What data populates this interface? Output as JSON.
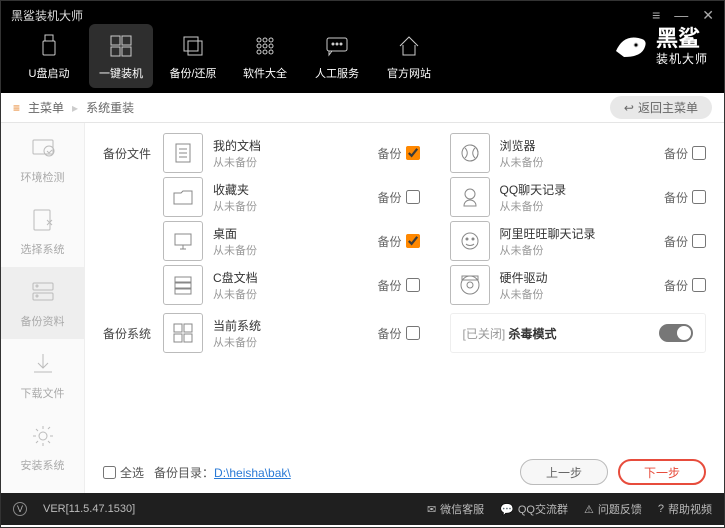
{
  "app_title": "黑鲨装机大师",
  "winctl": {
    "menu": "≡",
    "min": "—",
    "close": "✕"
  },
  "brand": {
    "name": "黑鲨",
    "sub": "装机大师"
  },
  "nav": [
    {
      "label": "U盘启动",
      "icon": "usb"
    },
    {
      "label": "一键装机",
      "icon": "windows"
    },
    {
      "label": "备份/还原",
      "icon": "backup"
    },
    {
      "label": "软件大全",
      "icon": "grid"
    },
    {
      "label": "人工服务",
      "icon": "chat"
    },
    {
      "label": "官方网站",
      "icon": "home"
    }
  ],
  "crumb": {
    "icon": "≡",
    "a": "主菜单",
    "sep": "▸",
    "b": "系统重装",
    "return": "返回主菜单"
  },
  "side": [
    {
      "label": "环境检测"
    },
    {
      "label": "选择系统"
    },
    {
      "label": "备份资料"
    },
    {
      "label": "下载文件"
    },
    {
      "label": "安装系统"
    }
  ],
  "section_backup_files": "备份文件",
  "section_backup_system": "备份系统",
  "bk_label": "备份",
  "never": "从未备份",
  "items_left": [
    {
      "name": "我的文档",
      "checked": true
    },
    {
      "name": "收藏夹",
      "checked": false
    },
    {
      "name": "桌面",
      "checked": true
    },
    {
      "name": "C盘文档",
      "checked": false
    }
  ],
  "items_right": [
    {
      "name": "浏览器",
      "checked": false
    },
    {
      "name": "QQ聊天记录",
      "checked": false
    },
    {
      "name": "阿里旺旺聊天记录",
      "checked": false
    },
    {
      "name": "硬件驱动",
      "checked": false
    }
  ],
  "sys_item": {
    "name": "当前系统",
    "checked": false
  },
  "kill": {
    "prefix": "[已关闭] ",
    "label": "杀毒模式"
  },
  "foot": {
    "all": "全选",
    "dir_lbl": "备份目录：",
    "dir": "D:\\heisha\\bak\\",
    "prev": "上一步",
    "next": "下一步"
  },
  "status": {
    "ver": "VER[11.5.47.1530]",
    "wx": "微信客服",
    "qq": "QQ交流群",
    "fb": "问题反馈",
    "help": "帮助视频"
  }
}
